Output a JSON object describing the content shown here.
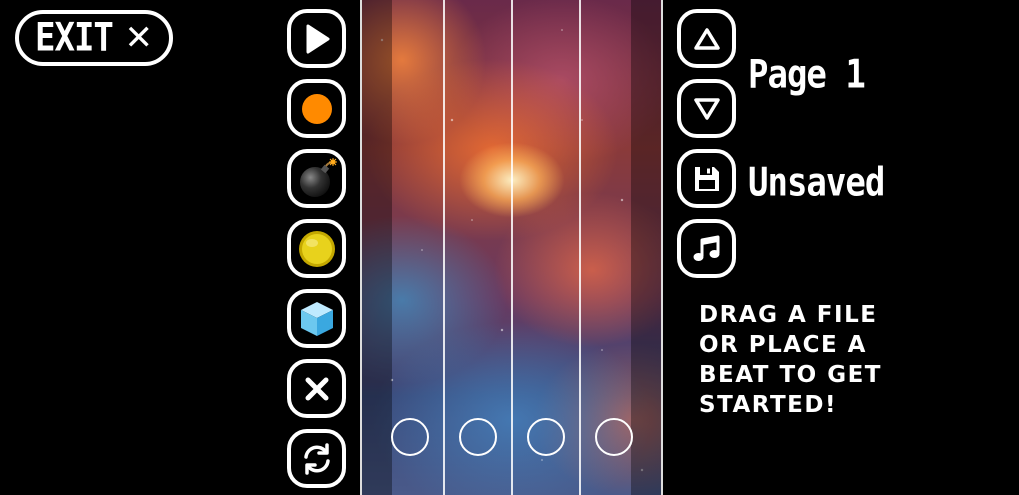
{
  "exit_button": {
    "label": "EXIT",
    "close_glyph": "✕"
  },
  "left_toolbar": [
    {
      "name": "play-button",
      "icon": "play-icon"
    },
    {
      "name": "orange-beat-button",
      "icon": "orange-circle-icon",
      "color": "#ff8a00"
    },
    {
      "name": "bomb-button",
      "icon": "bomb-icon"
    },
    {
      "name": "gold-coin-button",
      "icon": "gold-coin-icon",
      "color": "#e8d21c"
    },
    {
      "name": "ice-block-button",
      "icon": "ice-cube-icon",
      "color": "#6cc8ef"
    },
    {
      "name": "delete-button",
      "icon": "x-icon"
    },
    {
      "name": "reset-button",
      "icon": "refresh-icon"
    }
  ],
  "right_toolbar": [
    {
      "name": "page-up-button",
      "icon": "triangle-up-icon"
    },
    {
      "name": "page-down-button",
      "icon": "triangle-down-icon"
    },
    {
      "name": "save-button",
      "icon": "floppy-disk-icon"
    },
    {
      "name": "music-button",
      "icon": "music-note-icon"
    }
  ],
  "page_label": "Page 1",
  "save_status": "Unsaved",
  "instructions": [
    "DRAG A FILE",
    "OR PLACE A",
    "BEAT TO GET",
    "STARTED!"
  ],
  "lanes": 4
}
